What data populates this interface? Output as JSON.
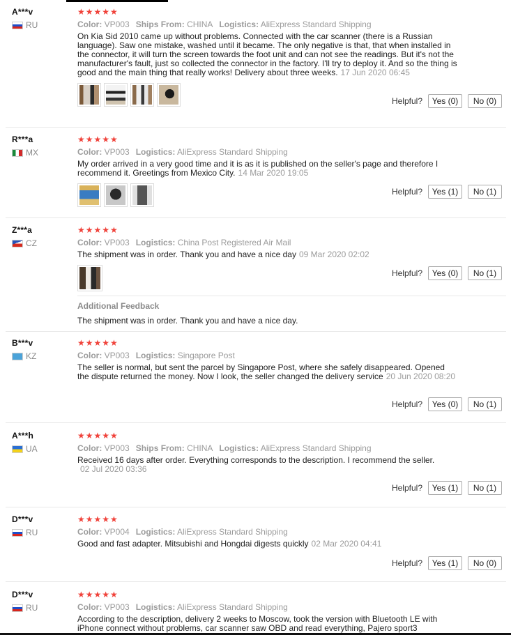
{
  "helpful_label": "Helpful?",
  "reviews": [
    {
      "user": "A***v",
      "country": "RU",
      "stars": "★★★★★",
      "color_label": "Color:",
      "color": "VP003",
      "ships_label": "Ships From:",
      "ships": "CHINA",
      "logistics_label": "Logistics:",
      "logistics": "AliExpress Standard Shipping",
      "text": "On Kia Sid 2010 came up without problems. Connected with the car scanner (there is a Russian language). Saw one mistake, washed until it became. The only negative is that, that when installed in the connector, it will turn the screen towards the foot unit and can not see the readings. But it's not the manufacturer's fault, just so collected the connector in the factory. I'll try to deploy it. And so the thing is good and the main thing that really works! Delivery about three weeks.",
      "date": "17 Jun 2020 06:45",
      "yes": "Yes (0)",
      "no": "No (0)"
    },
    {
      "user": "R***a",
      "country": "MX",
      "stars": "★★★★★",
      "color_label": "Color:",
      "color": "VP003",
      "logistics_label": "Logistics:",
      "logistics": "AliExpress Standard Shipping",
      "text": "My order arrived in a very good time and it is as it is published on the seller's page and therefore I recommend it. Greetings from Mexico City.",
      "date": "14 Mar 2020 19:05",
      "yes": "Yes (1)",
      "no": "No (1)"
    },
    {
      "user": "Z***a",
      "country": "CZ",
      "stars": "★★★★★",
      "color_label": "Color:",
      "color": "VP003",
      "logistics_label": "Logistics:",
      "logistics": "China Post Registered Air Mail",
      "text": "The shipment was in order. Thank you and have a nice day",
      "date": "09 Mar 2020 02:02",
      "yes": "Yes (0)",
      "no": "No (1)",
      "additional_title": "Additional Feedback",
      "additional_text": "The shipment was in order. Thank you and have a nice day."
    },
    {
      "user": "B***v",
      "country": "KZ",
      "stars": "★★★★★",
      "color_label": "Color:",
      "color": "VP003",
      "logistics_label": "Logistics:",
      "logistics": "Singapore Post",
      "text": "The seller is normal, but sent the parcel by Singapore Post, where she safely disappeared. Opened the dispute returned the money. Now I look, the seller changed the delivery service",
      "date": "20 Jun 2020 08:20",
      "yes": "Yes (0)",
      "no": "No (1)"
    },
    {
      "user": "A***h",
      "country": "UA",
      "stars": "★★★★★",
      "color_label": "Color:",
      "color": "VP003",
      "ships_label": "Ships From:",
      "ships": "CHINA",
      "logistics_label": "Logistics:",
      "logistics": "AliExpress Standard Shipping",
      "text": "Received 16 days after order. Everything corresponds to the description. I recommend the seller.",
      "date": "02 Jul 2020 03:36",
      "yes": "Yes (1)",
      "no": "No (1)"
    },
    {
      "user": "D***v",
      "country": "RU",
      "stars": "★★★★★",
      "color_label": "Color:",
      "color": "VP004",
      "logistics_label": "Logistics:",
      "logistics": "AliExpress Standard Shipping",
      "text": "Good and fast adapter. Mitsubishi and Hongdai digests quickly",
      "date": "02 Mar 2020 04:41",
      "yes": "Yes (1)",
      "no": "No (0)"
    },
    {
      "user": "D***v",
      "country": "RU",
      "stars": "★★★★★",
      "color_label": "Color:",
      "color": "VP003",
      "logistics_label": "Logistics:",
      "logistics": "AliExpress Standard Shipping",
      "text": "According to the description, delivery 2 weeks to Moscow, took the version with Bluetooth LE with iPhone connect without problems, car scanner saw OBD and read everything, Pajero sport3"
    }
  ]
}
